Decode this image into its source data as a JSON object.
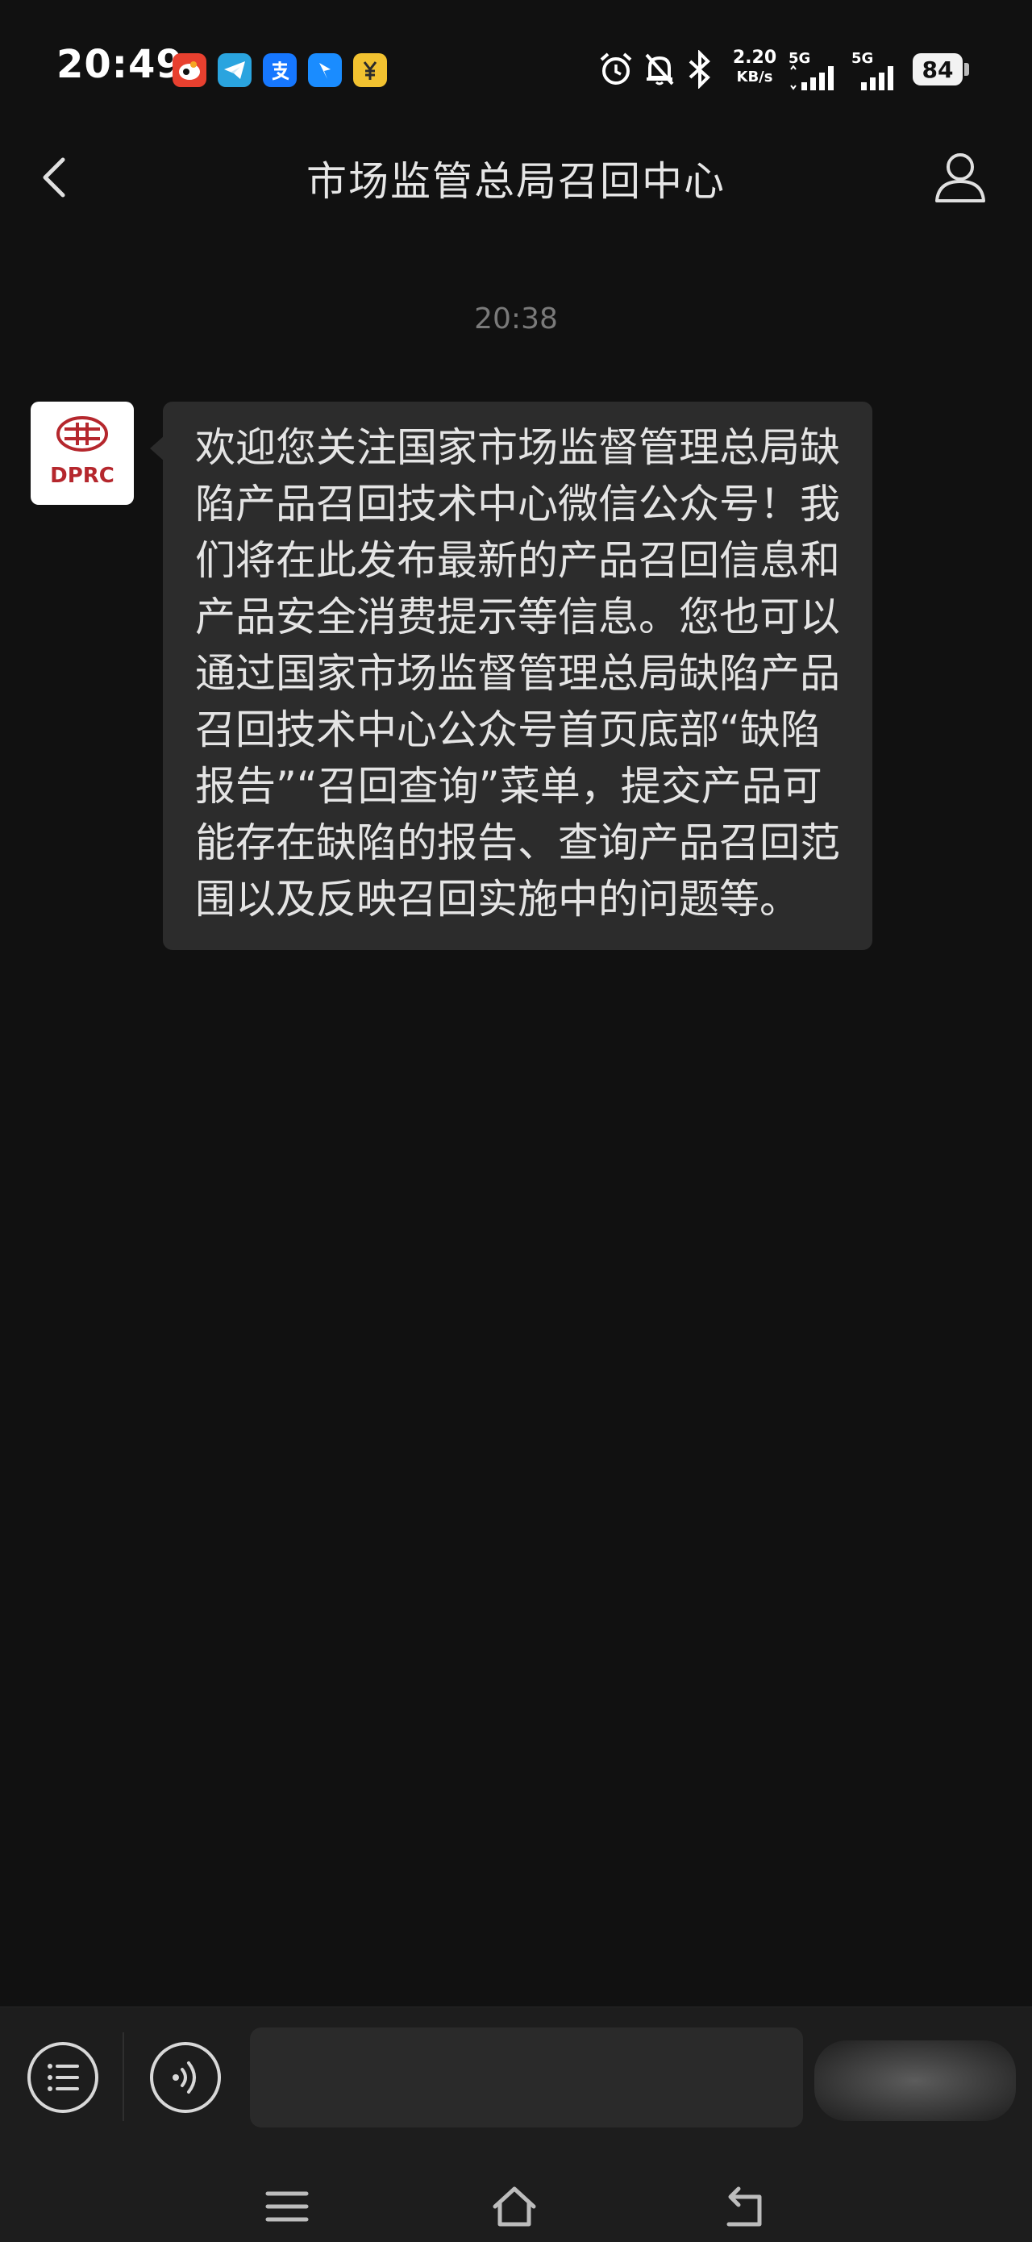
{
  "status_bar": {
    "time": "20:49",
    "network_speed_value": "2.20",
    "network_speed_unit": "KB/s",
    "sim1_label": "5G",
    "sim2_label": "5G",
    "battery_level": "84",
    "app_icons": [
      "weibo-icon",
      "telegram-icon",
      "alipay-icon",
      "mapping-icon",
      "yuan-payment-icon"
    ],
    "system_icons": [
      "alarm-icon",
      "mute-icon",
      "bluetooth-icon"
    ]
  },
  "header": {
    "title": "市场监管总局召回中心"
  },
  "chat": {
    "timestamp": "20:38",
    "avatar_logo_text": "DPRC",
    "messages": [
      {
        "sender": "official-account",
        "text": "欢迎您关注国家市场监督管理总局缺陷产品召回技术中心微信公众号！我们将在此发布最新的产品召回信息和产品安全消费提示等信息。您也可以通过国家市场监督管理总局缺陷产品召回技术中心公众号首页底部“缺陷报告”“召回查询”菜单，提交产品可能存在缺陷的报告、查询产品召回范围以及反映召回实施中的问题等。"
      }
    ]
  },
  "input_bar": {
    "menu_icon": "list-menu-icon",
    "voice_icon": "voice-icon",
    "input_value": "",
    "input_placeholder": ""
  },
  "nav_bar": {
    "icons": [
      "menu-lines-icon",
      "home-icon",
      "back-arrow-icon"
    ]
  },
  "colors": {
    "background": "#111111",
    "bubble": "#2c2c2c",
    "logo_red": "#b5272d"
  }
}
